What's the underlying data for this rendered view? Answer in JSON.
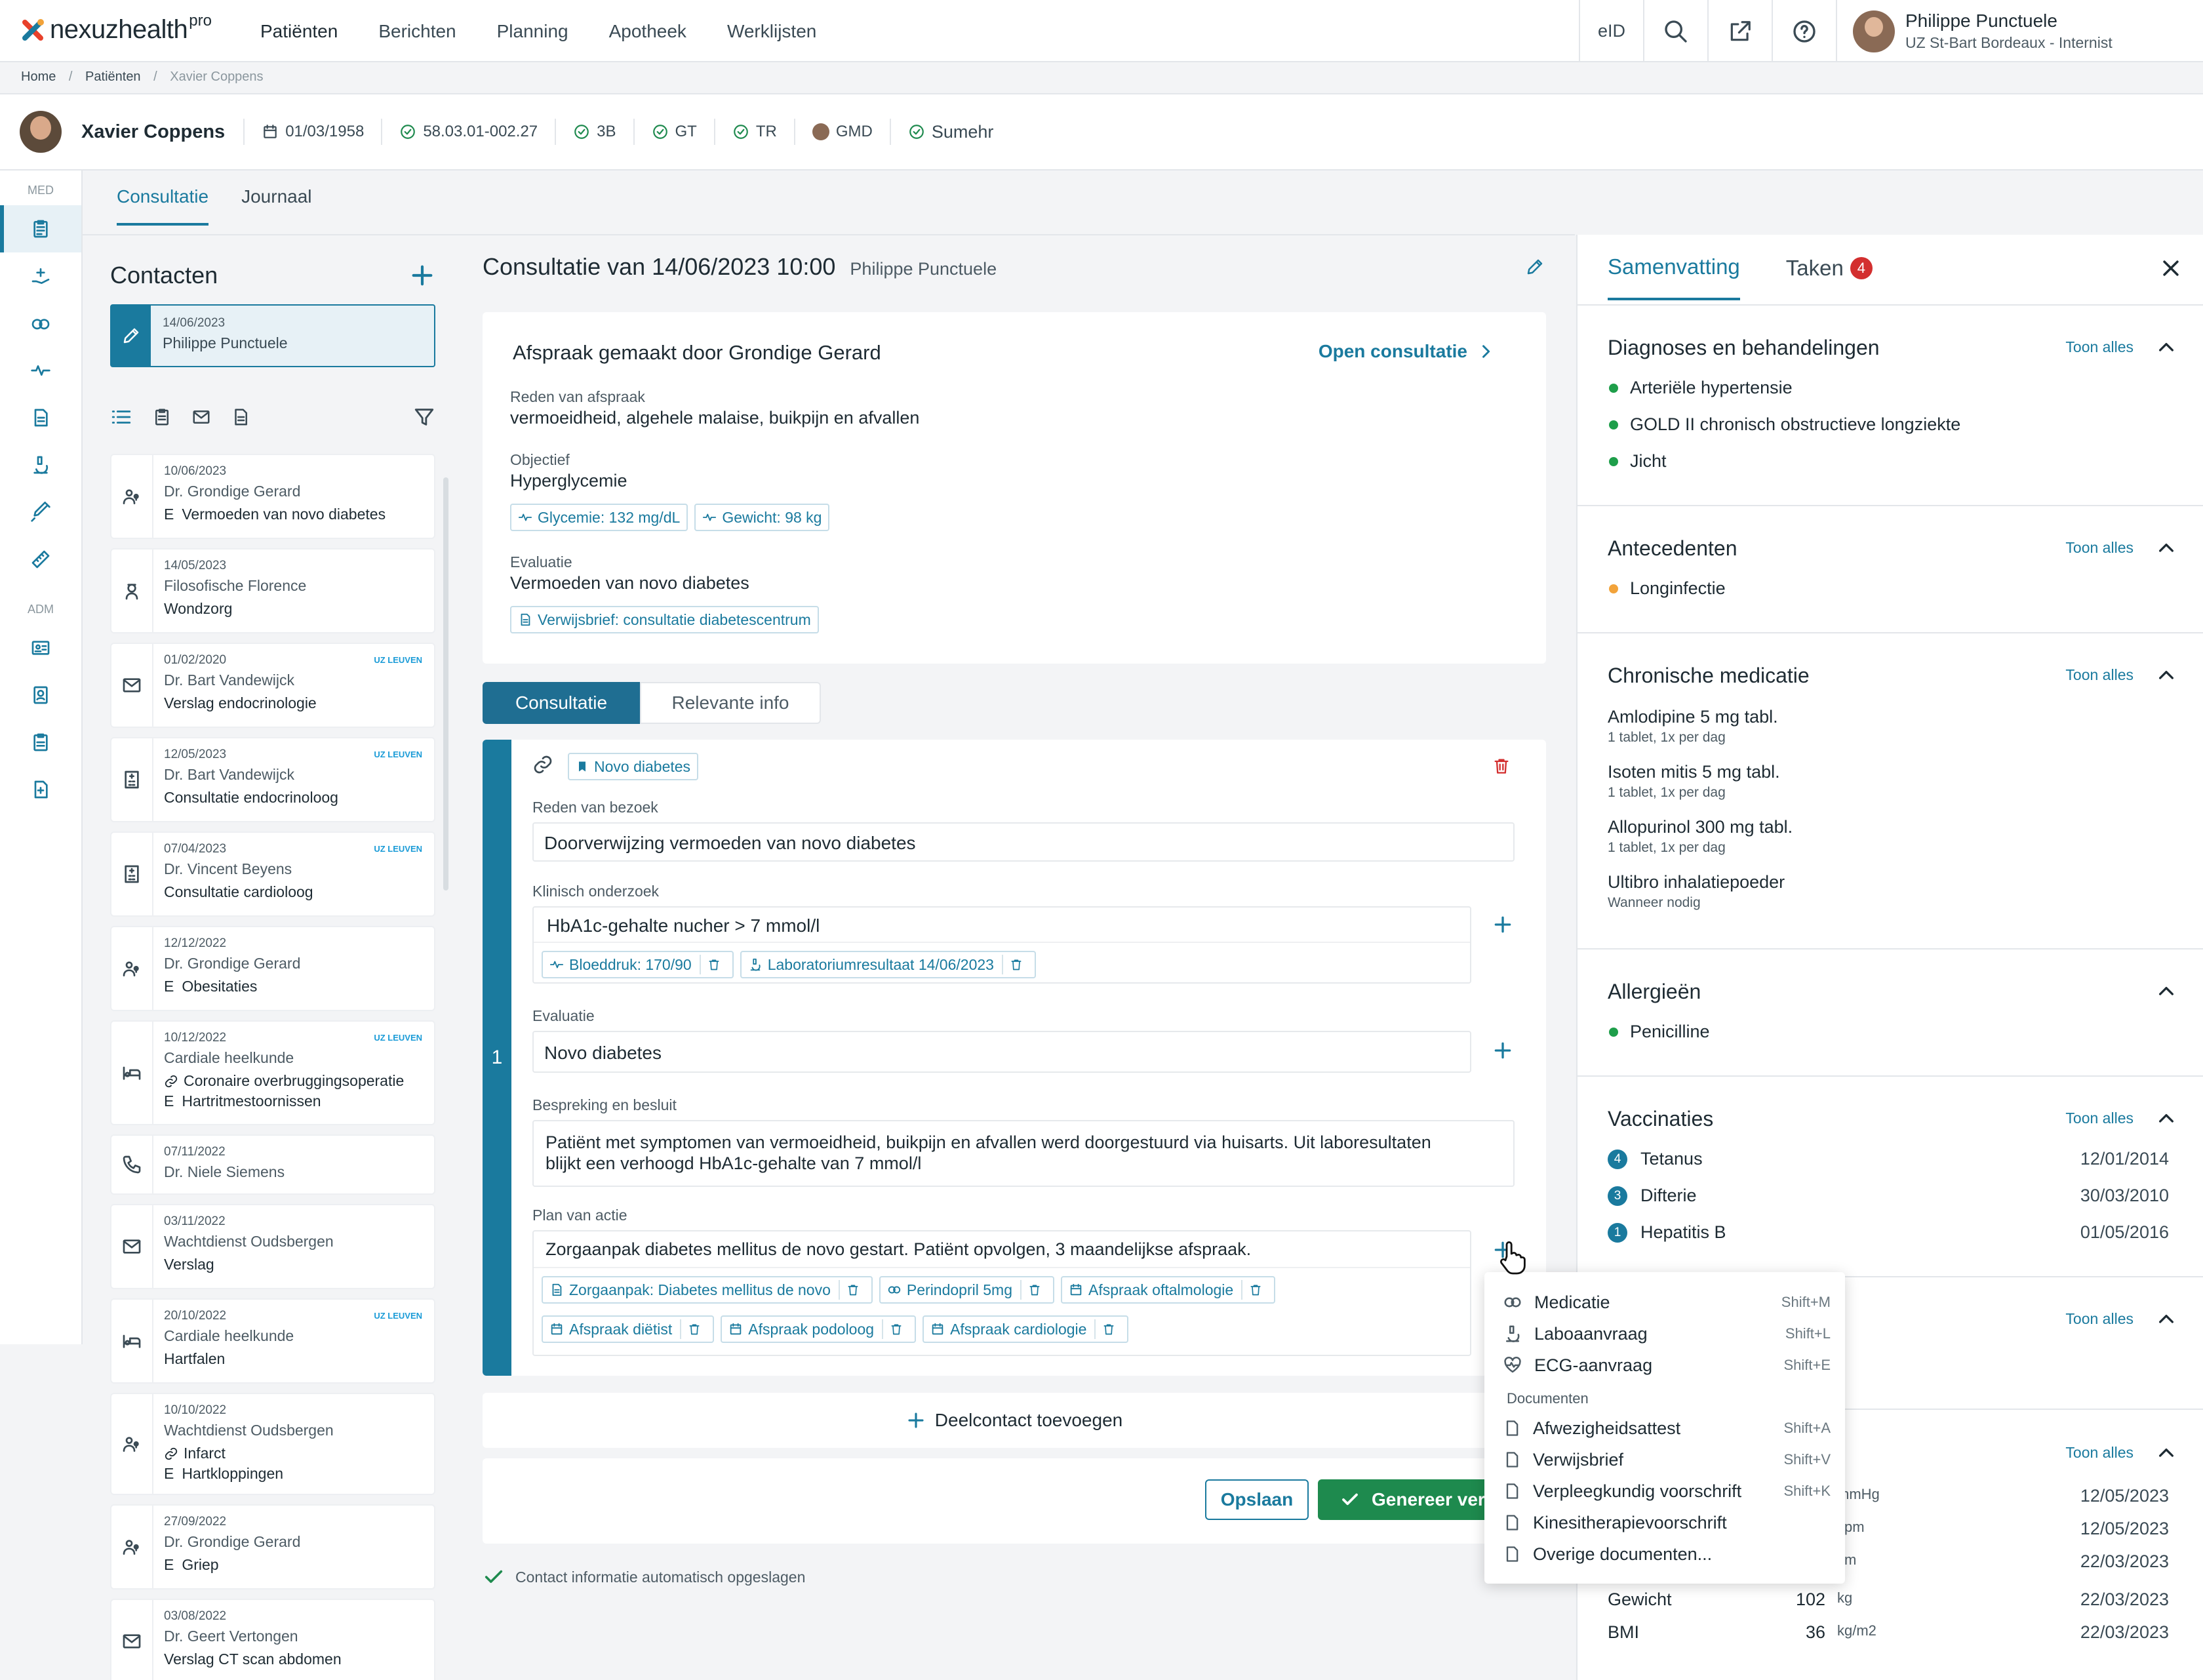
{
  "app": {
    "brand": "nexuzhealth",
    "brand_sup": "pro"
  },
  "nav": [
    "Patiënten",
    "Berichten",
    "Planning",
    "Apotheek",
    "Werklijsten"
  ],
  "topbar": {
    "eid": "eID",
    "user_name": "Philippe Punctuele",
    "user_role": "UZ St-Bart Bordeaux - Internist"
  },
  "breadcrumb": [
    "Home",
    "/",
    "Patiënten",
    "/",
    "Xavier Coppens"
  ],
  "patient": {
    "name": "Xavier Coppens",
    "dob": "01/03/1958",
    "ins": "58.03.01-002.27",
    "items": [
      "3B",
      "GT",
      "TR",
      "GMD",
      "Sumehr"
    ]
  },
  "sidebar": {
    "med": "MED",
    "adm": "ADM"
  },
  "tabs": [
    "Consultatie",
    "Journaal"
  ],
  "contacts": {
    "title": "Contacten",
    "selected": {
      "date": "14/06/2023",
      "doc": "Philippe Punctuele"
    },
    "items": [
      {
        "date": "10/06/2023",
        "doc": "Dr. Grondige Gerard",
        "desc": "Vermoeden van novo diabetes",
        "e": "E"
      },
      {
        "date": "14/05/2023",
        "doc": "Filosofische Florence",
        "desc": "Wondzorg"
      },
      {
        "date": "01/02/2020",
        "doc": "Dr. Bart Vandewijck",
        "desc": "Verslag endocrinologie",
        "uz": "UZ LEUVEN"
      },
      {
        "date": "12/05/2023",
        "doc": "Dr. Bart Vandewijck",
        "desc": "Consultatie endocrinoloog",
        "uz": "UZ LEUVEN"
      },
      {
        "date": "07/04/2023",
        "doc": "Dr. Vincent Beyens",
        "desc": "Consultatie cardioloog",
        "uz": "UZ LEUVEN"
      },
      {
        "date": "12/12/2022",
        "doc": "Dr. Grondige Gerard",
        "desc": "Obesitaties",
        "e": "E"
      },
      {
        "date": "10/12/2022",
        "doc": "Cardiale heelkunde",
        "desc": "Coronaire overbruggingsoperatie",
        "desc2": "Hartritmestoornissen",
        "e": "E",
        "uz": "UZ LEUVEN"
      },
      {
        "date": "07/11/2022",
        "doc": "Dr. Niele Siemens"
      },
      {
        "date": "03/11/2022",
        "doc": "Wachtdienst Oudsbergen",
        "desc": "Verslag"
      },
      {
        "date": "20/10/2022",
        "doc": "Cardiale heelkunde",
        "desc": "Hartfalen",
        "uz": "UZ LEUVEN"
      },
      {
        "date": "10/10/2022",
        "doc": "Wachtdienst Oudsbergen",
        "desc": "Infarct",
        "desc2": "Hartkloppingen",
        "e": "E"
      },
      {
        "date": "27/09/2022",
        "doc": "Dr. Grondige Gerard",
        "desc": "Griep",
        "e": "E"
      },
      {
        "date": "03/08/2022",
        "doc": "Dr. Geert Vertongen",
        "desc": "Verslag CT scan abdomen"
      }
    ]
  },
  "consult": {
    "title": "Consultatie van 14/06/2023 10:00",
    "by": "Philippe Punctuele",
    "appt_title": "Afspraak gemaakt door Grondige Gerard",
    "open": "Open consultatie",
    "reason_lbl": "Reden van afspraak",
    "reason": "vermoeidheid, algehele malaise, buikpijn en afvallen",
    "obj_lbl": "Objectief",
    "obj": "Hyperglycemie",
    "chip_gly": "Glycemie: 132 mg/dL",
    "chip_gew": "Gewicht: 98 kg",
    "eval_lbl": "Evaluatie",
    "eval": "Vermoeden van novo diabetes",
    "chip_ref": "Verwijsbrief: consultatie diabetescentrum",
    "seg": [
      "Consultatie",
      "Relevante info"
    ],
    "sub_num": "1",
    "tag": "Novo diabetes",
    "visit_lbl": "Reden van bezoek",
    "visit": "Doorverwijzing vermoeden van novo diabetes",
    "klin_lbl": "Klinisch onderzoek",
    "klin": "HbA1c-gehalte nucher > 7 mmol/l",
    "chip_bd": "Bloeddruk: 170/90",
    "chip_lab": "Laboratoriumresultaat 14/06/2023",
    "ev2_lbl": "Evaluatie",
    "ev2": "Novo diabetes",
    "besp_lbl": "Bespreking en besluit",
    "besp1": "Patiënt met symptomen van vermoeidheid, buikpijn en afvallen werd doorgestuurd via huisarts. Uit laboresultaten",
    "besp2": "blijkt een verhoogd HbA1c-gehalte van 7 mmol/l",
    "plan_lbl": "Plan van actie",
    "plan": "Zorgaanpak diabetes mellitus de novo gestart. Patiënt opvolgen, 3 maandelijkse afspraak.",
    "plan_chips": [
      "Zorgaanpak: Diabetes mellitus de novo",
      "Perindopril 5mg",
      "Afspraak oftalmologie",
      "Afspraak diëtist",
      "Afspraak podoloog",
      "Afspraak cardiologie"
    ],
    "add": "Deelcontact toevoegen",
    "save": "Opslaan",
    "generate": "Genereer vers",
    "saved": "Contact informatie automatisch opgeslagen"
  },
  "right": {
    "tabs": [
      "Samenvatting",
      "Taken"
    ],
    "taken_badge": "4",
    "toon": "Toon alles",
    "diag_title": "Diagnoses en behandelingen",
    "diag": [
      "Arteriële hypertensie",
      "GOLD II chronisch obstructieve longziekte",
      "Jicht"
    ],
    "ante_title": "Antecedenten",
    "ante": [
      "Longinfectie"
    ],
    "med_title": "Chronische medicatie",
    "meds": [
      {
        "n": "Amlodipine 5 mg tabl.",
        "d": "1 tablet, 1x per dag"
      },
      {
        "n": "Isoten mitis 5 mg tabl.",
        "d": "1 tablet, 1x per dag"
      },
      {
        "n": "Allopurinol 300 mg tabl.",
        "d": "1 tablet, 1x per dag"
      },
      {
        "n": "Ultibro inhalatiepoeder",
        "d": "Wanneer nodig"
      }
    ],
    "all_title": "Allergieën",
    "all": [
      "Penicilline"
    ],
    "vac_title": "Vaccinaties",
    "vacs": [
      {
        "num": "4",
        "n": "Tetanus",
        "d": "12/01/2014"
      },
      {
        "num": "3",
        "n": "Difterie",
        "d": "30/03/2010"
      },
      {
        "num": "1",
        "n": "Hepatitis B",
        "d": "01/05/2016"
      }
    ],
    "params": [
      {
        "n": "",
        "v": "",
        "u": "mmHg",
        "d": "12/05/2023"
      },
      {
        "n": "",
        "v": "",
        "u": "spm",
        "d": "12/05/2023"
      },
      {
        "n": "",
        "v": "",
        "u": "cm",
        "d": "22/03/2023"
      },
      {
        "n": "Gewicht",
        "v": "102",
        "u": "kg",
        "d": "22/03/2023"
      },
      {
        "n": "BMI",
        "v": "36",
        "u": "kg/m2",
        "d": "22/03/2023"
      }
    ]
  },
  "menu": {
    "items": [
      {
        "l": "Medicatie",
        "s": "Shift+M"
      },
      {
        "l": "Laboaanvraag",
        "s": "Shift+L"
      },
      {
        "l": "ECG-aanvraag",
        "s": "Shift+E"
      }
    ],
    "group": "Documenten",
    "docs": [
      {
        "l": "Afwezigheidsattest",
        "s": "Shift+A"
      },
      {
        "l": "Verwijsbrief",
        "s": "Shift+V"
      },
      {
        "l": "Verpleegkundig voorschrift",
        "s": "Shift+K"
      },
      {
        "l": "Kinesitherapievoorschrift",
        "s": ""
      },
      {
        "l": "Overige documenten...",
        "s": ""
      }
    ]
  },
  "colors": {
    "accent": "#1a7a9e",
    "success": "#1e8a4e",
    "danger": "#d32f2f",
    "dot_green": "#1e9e4a",
    "dot_orange": "#f2a33a"
  }
}
